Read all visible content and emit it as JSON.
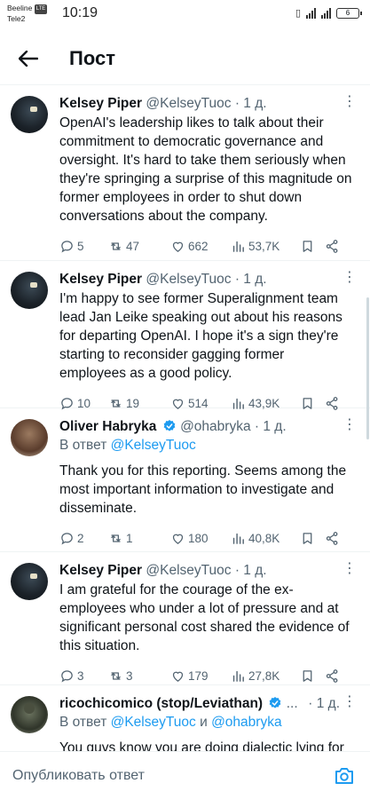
{
  "status_bar": {
    "carrier_1": "Beeline",
    "carrier_1_badge": "LTE",
    "carrier_2": "Tele2",
    "time": "10:19",
    "battery": "6"
  },
  "header": {
    "title": "Пост"
  },
  "tweets": [
    {
      "name": "Kelsey Piper",
      "handle": "@KelseyTuoc",
      "time": "· 1 д.",
      "text": "OpenAI's leadership likes to talk about their commitment to democratic governance and oversight. It's hard to take them seriously when they're springing a surprise of this magnitude on former employees in order to shut down conversations about the company.",
      "replies": "5",
      "retweets": "47",
      "likes": "662",
      "views": "53,7K"
    },
    {
      "name": "Kelsey Piper",
      "handle": "@KelseyTuoc",
      "time": "· 1 д.",
      "text": "I'm happy to see former Superalignment team lead Jan Leike speaking out about his reasons for departing OpenAI. I hope it's a sign they're starting to reconsider gagging former employees as a good policy.",
      "replies": "10",
      "retweets": "19",
      "likes": "514",
      "views": "43,9K"
    },
    {
      "name": "Oliver Habryka",
      "handle": "@ohabryka",
      "time": "· 1 д.",
      "reply_prefix": "В ответ",
      "reply_mention_1": "@KelseyTuoc",
      "text": "Thank you for this reporting. Seems among the most important information to investigate and disseminate.",
      "replies": "2",
      "retweets": "1",
      "likes": "180",
      "views": "40,8K"
    },
    {
      "name": "Kelsey Piper",
      "handle": "@KelseyTuoc",
      "time": "· 1 д.",
      "text": "I am grateful for the courage of the ex-employees who under a lot of pressure and at significant personal cost shared the evidence of this situation.",
      "replies": "3",
      "retweets": "3",
      "likes": "179",
      "views": "27,8K"
    },
    {
      "name": "ricochicomico (stop/Leviathan)",
      "handle": "...",
      "time": "· 1 д.",
      "reply_prefix": "В ответ",
      "reply_mention_1": "@KelseyTuoc",
      "reply_joiner": "и",
      "reply_mention_2": "@ohabryka",
      "text": "You guys know you are doing dialectic lying for"
    }
  ],
  "composer": {
    "placeholder": "Опубликовать ответ"
  },
  "colors": {
    "accent": "#1d9bf0",
    "text": "#0f1419",
    "secondary": "#536471",
    "divider": "#eff3f4"
  },
  "icons": [
    "back-arrow-icon",
    "reply-icon",
    "retweet-icon",
    "like-icon",
    "views-icon",
    "bookmark-icon",
    "share-icon",
    "verified-icon",
    "camera-icon"
  ]
}
